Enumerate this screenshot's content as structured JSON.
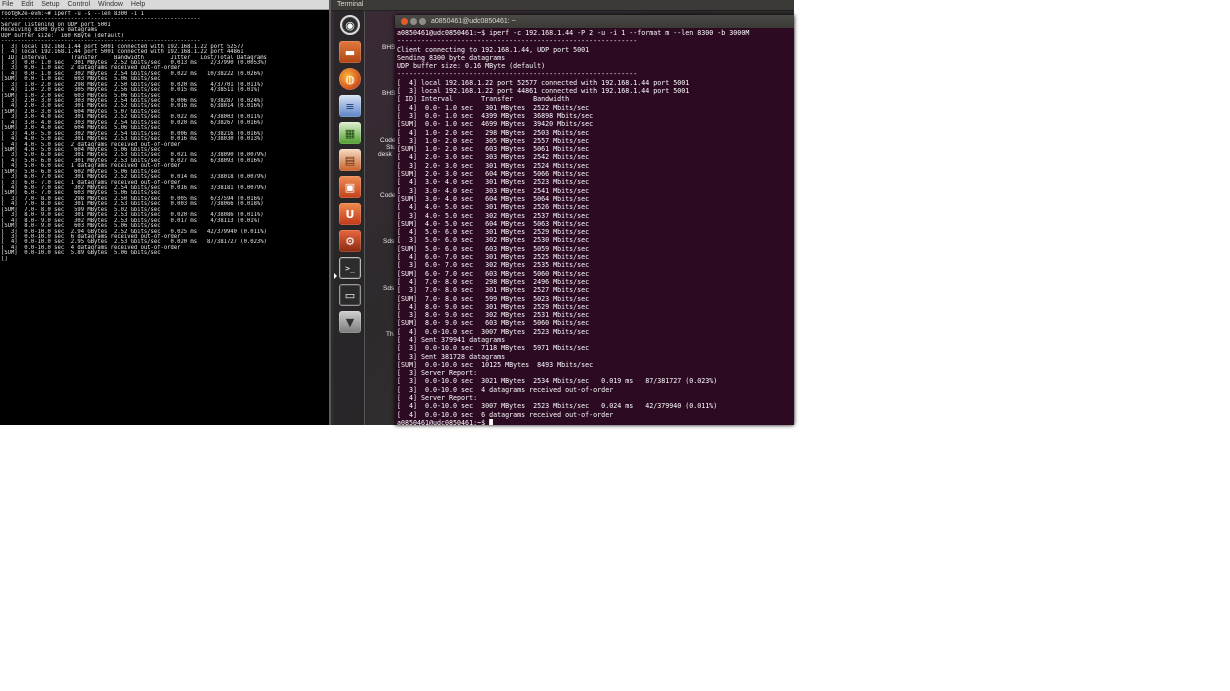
{
  "left_window": {
    "menu": [
      "File",
      "Edit",
      "Setup",
      "Control",
      "Window",
      "Help"
    ],
    "lines": [
      "root@k2e-evm:~# iperf -u -s --len 8300 -i 1",
      "------------------------------------------------------------",
      "Server listening on UDP port 5001",
      "Receiving 8300 byte datagrams",
      "UDP buffer size:  160 KByte (default)",
      "------------------------------------------------------------",
      "[  3] local 192.168.1.44 port 5001 connected with 192.168.1.22 port 52577",
      "[  4] local 192.168.1.44 port 5001 connected with 192.168.1.22 port 44861",
      "[ ID] Interval       Transfer     Bandwidth        Jitter   Lost/Total Datagrams",
      "[  3]  0.0- 1.0 sec   301 MBytes  2.52 Gbits/sec   0.013 ms    2/37990 (0.0053%)",
      "[  3]  0.0- 1.0 sec  2 datagrams received out-of-order",
      "[  4]  0.0- 1.0 sec   302 MBytes  2.54 Gbits/sec   0.022 ms   10/38222 (0.026%)",
      "[SUM]  0.0- 1.0 sec   603 MBytes  5.06 Gbits/sec",
      "[  3]  1.0- 2.0 sec   298 MBytes  2.50 Gbits/sec   0.020 ms    4/37701 (0.011%)",
      "[  4]  1.0- 2.0 sec   305 MBytes  2.56 Gbits/sec   0.015 ms    4/38511 (0.01%)",
      "[SUM]  1.0- 2.0 sec   603 MBytes  5.06 Gbits/sec",
      "[  3]  2.0- 3.0 sec   303 MBytes  2.54 Gbits/sec   0.006 ms    9/38287 (0.024%)",
      "[  4]  2.0- 3.0 sec   301 MBytes  2.52 Gbits/sec   0.016 ms    6/38014 (0.016%)",
      "[SUM]  2.0- 3.0 sec   604 MBytes  5.07 Gbits/sec",
      "[  3]  3.0- 4.0 sec   301 MBytes  2.52 Gbits/sec   0.022 ms    4/38003 (0.011%)",
      "[  4]  3.0- 4.0 sec   303 MBytes  2.54 Gbits/sec   0.020 ms    6/38267 (0.016%)",
      "[SUM]  3.0- 4.0 sec   604 MBytes  5.06 Gbits/sec",
      "[  3]  4.0- 5.0 sec   302 MBytes  2.54 Gbits/sec   0.006 ms    6/38216 (0.016%)",
      "[  4]  4.0- 5.0 sec   301 MBytes  2.53 Gbits/sec   0.016 ms    5/38030 (0.013%)",
      "[  4]  4.0- 5.0 sec  2 datagrams received out-of-order",
      "[SUM]  4.0- 5.0 sec   604 MBytes  5.06 Gbits/sec",
      "[  3]  5.0- 6.0 sec   301 MBytes  2.53 Gbits/sec   0.021 ms    3/38090 (0.0079%)",
      "[  4]  5.0- 6.0 sec   301 MBytes  2.53 Gbits/sec   0.027 ms    6/38093 (0.016%)",
      "[  4]  5.0- 6.0 sec  1 datagrams received out-of-order",
      "[SUM]  5.0- 6.0 sec   602 MBytes  5.06 Gbits/sec",
      "[  3]  6.0- 7.0 sec   301 MBytes  2.52 Gbits/sec   0.014 ms    3/38018 (0.0079%)",
      "[  3]  6.0- 7.0 sec  1 datagrams received out-of-order",
      "[  4]  6.0- 7.0 sec   302 MBytes  2.54 Gbits/sec   0.016 ms    3/38181 (0.0079%)",
      "[SUM]  6.0- 7.0 sec   603 MBytes  5.06 Gbits/sec",
      "[  3]  7.0- 8.0 sec   298 MBytes  2.50 Gbits/sec   0.005 ms    6/37594 (0.016%)",
      "[  4]  7.0- 8.0 sec   301 MBytes  2.53 Gbits/sec   0.003 ms    7/38066 (0.018%)",
      "[SUM]  7.0- 8.0 sec   599 MBytes  5.02 Gbits/sec",
      "[  3]  8.0- 9.0 sec   301 MBytes  2.53 Gbits/sec   0.020 ms    4/38086 (0.011%)",
      "[  4]  8.0- 9.0 sec   302 MBytes  2.53 Gbits/sec   0.017 ms    4/38113 (0.01%)",
      "[SUM]  8.0- 9.0 sec   603 MBytes  5.06 Gbits/sec",
      "[  3]  0.0-10.0 sec  2.94 GBytes  2.52 Gbits/sec   0.025 ms   42/379940 (0.011%)",
      "[  3]  0.0-10.0 sec  6 datagrams received out-of-order",
      "[  4]  0.0-10.0 sec  2.95 GBytes  2.53 Gbits/sec   0.020 ms   87/381727 (0.023%)",
      "[  4]  0.0-10.0 sec  4 datagrams received out-of-order",
      "[SUM]  0.0-10.0 sec  5.89 GBytes  5.06 Gbits/sec",
      "[]"
    ]
  },
  "top_panel": {
    "title": "Terminal"
  },
  "launcher": {
    "items": [
      {
        "id": "dash",
        "glyph": "◉"
      },
      {
        "id": "files",
        "glyph": "▬"
      },
      {
        "id": "firefox",
        "glyph": "◍"
      },
      {
        "id": "writer",
        "glyph": "≡"
      },
      {
        "id": "calc",
        "glyph": "▦"
      },
      {
        "id": "impress",
        "glyph": "▤"
      },
      {
        "id": "software",
        "glyph": "▣"
      },
      {
        "id": "ubuntuone",
        "glyph": "U"
      },
      {
        "id": "settings",
        "glyph": "⚙"
      },
      {
        "id": "terminal",
        "glyph": ">_"
      },
      {
        "id": "workspace",
        "glyph": "▭"
      },
      {
        "id": "trash",
        "glyph": "▼"
      }
    ]
  },
  "desktop_labels": [
    "BHS",
    "BHS",
    "Code",
    "Stu",
    "desk",
    "Code",
    "Sds",
    "Sds",
    "Th"
  ],
  "terminal": {
    "title": "a0850461@udc0850461: ~",
    "lines": [
      "a0850461@udc0850461:~$ iperf -c 192.168.1.44 -P 2 -u -i 1 --format m --len 8300 -b 3000M",
      "------------------------------------------------------------",
      "Client connecting to 192.168.1.44, UDP port 5001",
      "Sending 8300 byte datagrams",
      "UDP buffer size: 0.16 MByte (default)",
      "------------------------------------------------------------",
      "[  4] local 192.168.1.22 port 52577 connected with 192.168.1.44 port 5001",
      "[  3] local 192.168.1.22 port 44861 connected with 192.168.1.44 port 5001",
      "[ ID] Interval       Transfer     Bandwidth",
      "[  4]  0.0- 1.0 sec   301 MBytes  2522 Mbits/sec",
      "[  3]  0.0- 1.0 sec  4399 MBytes  36898 Mbits/sec",
      "[SUM]  0.0- 1.0 sec  4699 MBytes  39420 Mbits/sec",
      "[  4]  1.0- 2.0 sec   298 MBytes  2503 Mbits/sec",
      "[  3]  1.0- 2.0 sec   305 MBytes  2557 Mbits/sec",
      "[SUM]  1.0- 2.0 sec   603 MBytes  5061 Mbits/sec",
      "[  4]  2.0- 3.0 sec   303 MBytes  2542 Mbits/sec",
      "[  3]  2.0- 3.0 sec   301 MBytes  2524 Mbits/sec",
      "[SUM]  2.0- 3.0 sec   604 MBytes  5066 Mbits/sec",
      "[  4]  3.0- 4.0 sec   301 MBytes  2523 Mbits/sec",
      "[  3]  3.0- 4.0 sec   303 MBytes  2541 Mbits/sec",
      "[SUM]  3.0- 4.0 sec   604 MBytes  5064 Mbits/sec",
      "[  4]  4.0- 5.0 sec   301 MBytes  2526 Mbits/sec",
      "[  3]  4.0- 5.0 sec   302 MBytes  2537 Mbits/sec",
      "[SUM]  4.0- 5.0 sec   604 MBytes  5063 Mbits/sec",
      "[  4]  5.0- 6.0 sec   301 MBytes  2529 Mbits/sec",
      "[  3]  5.0- 6.0 sec   302 MBytes  2530 Mbits/sec",
      "[SUM]  5.0- 6.0 sec   603 MBytes  5059 Mbits/sec",
      "[  4]  6.0- 7.0 sec   301 MBytes  2525 Mbits/sec",
      "[  3]  6.0- 7.0 sec   302 MBytes  2535 Mbits/sec",
      "[SUM]  6.0- 7.0 sec   603 MBytes  5060 Mbits/sec",
      "[  4]  7.0- 8.0 sec   298 MBytes  2496 Mbits/sec",
      "[  3]  7.0- 8.0 sec   301 MBytes  2527 Mbits/sec",
      "[SUM]  7.0- 8.0 sec   599 MBytes  5023 Mbits/sec",
      "[  4]  8.0- 9.0 sec   301 MBytes  2529 Mbits/sec",
      "[  3]  8.0- 9.0 sec   302 MBytes  2531 Mbits/sec",
      "[SUM]  8.0- 9.0 sec   603 MBytes  5060 Mbits/sec",
      "[  4]  0.0-10.0 sec  3007 MBytes  2523 Mbits/sec",
      "[  4] Sent 379941 datagrams",
      "[  3]  0.0-10.0 sec  7118 MBytes  5971 Mbits/sec",
      "[  3] Sent 381728 datagrams",
      "[SUM]  0.0-10.0 sec  10125 MBytes  8493 Mbits/sec",
      "[  3] Server Report:",
      "[  3]  0.0-10.0 sec  3021 MBytes  2534 Mbits/sec   0.019 ms   87/381727 (0.023%)",
      "[  3]  0.0-10.0 sec  4 datagrams received out-of-order",
      "[  4] Server Report:",
      "[  4]  0.0-10.0 sec  3007 MBytes  2523 Mbits/sec   0.024 ms   42/379940 (0.011%)",
      "[  4]  0.0-10.0 sec  6 datagrams received out-of-order"
    ],
    "prompt": "a0850461@udc0850461:~$ "
  }
}
